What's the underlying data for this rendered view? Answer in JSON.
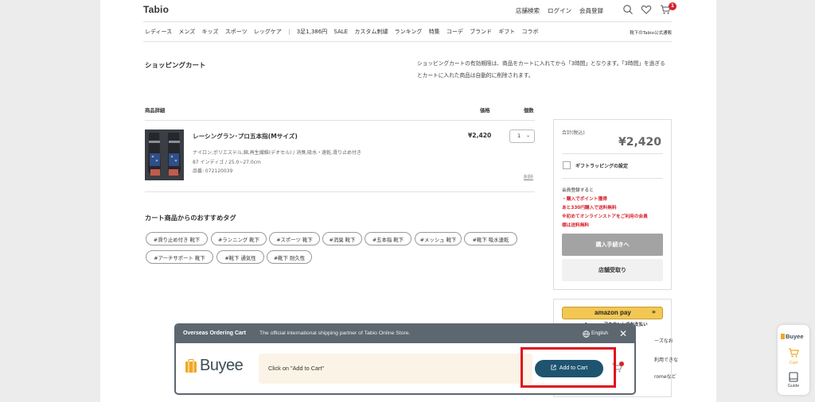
{
  "site": {
    "logo": "Tabio",
    "utility": [
      "店舗検索",
      "ログイン",
      "会員登録"
    ],
    "cart_count": "1",
    "nav": [
      "レディース",
      "メンズ",
      "キッズ",
      "スポーツ",
      "レッグケア",
      "3足1,386円",
      "SALE",
      "カスタム刺繍",
      "ランキング",
      "特集",
      "コーデ",
      "ブランド",
      "ギフト",
      "コラボ"
    ],
    "official_shop": "靴下のTabio公式通販"
  },
  "cart": {
    "title": "ショッピングカート",
    "expiry_note": "ショッピングカートの有効期限は、商品をカートに入れてから「3時間」となります。「3時間」を過ぎるとカートに入れた商品は自動的に削除されます。",
    "headers": {
      "product": "商品詳細",
      "price": "価格",
      "qty": "個数"
    },
    "item": {
      "name": "レーシングラン･プロ五本指(Mサイズ)",
      "material": "ナイロン,ポリエステル,綿,再生繊維(デオセル) / 消臭,吸水・速乾,滑り止め付き",
      "variant": "87 インディゴ / 25.0~27.0cm",
      "sku": "品番: 072120039",
      "price": "¥2,420",
      "qty": "1",
      "delete": "削除"
    },
    "recommend_title": "カート商品からのおすすめタグ",
    "tags": [
      "#滑り止め付き 靴下",
      "#ランニング 靴下",
      "#スポーツ 靴下",
      "#消臭 靴下",
      "#五本指 靴下",
      "#メッシュ 靴下",
      "#靴下 吸水速乾",
      "#アーチサポート 靴下",
      "#靴下 通気性",
      "#靴下 耐久性"
    ]
  },
  "summary": {
    "total_label": "合計(税込)",
    "total": "¥2,420",
    "gift_wrap": "ギフトラッピングの設定",
    "member_lines": [
      "会員登録すると",
      "・購入でポイント獲得",
      "あと330円購入で送料無料",
      "※初めてオンラインストアをご利用の会員",
      "様は送料無料"
    ],
    "checkout": "購入手続きへ",
    "store_pickup": "店舗受取り"
  },
  "amazon": {
    "label": "amazon pay",
    "note": "Amazonアカウントでお支払い",
    "fragments": [
      "ーズなお",
      "利用できな",
      "romeなど"
    ]
  },
  "buyee": {
    "head_title": "Overseas Ordering Cart",
    "head_tagline": "The official international shipping partner of Tabio Online Store.",
    "language": "English",
    "logo": "Buyee",
    "instruction": "Click on \"Add to Cart\"",
    "add_to_cart": "Add to Cart"
  },
  "dock": {
    "logo": "Buyee",
    "cart_label": "Cart",
    "guide_label": "Guide"
  },
  "colors": {
    "buyee_header": "#5c6770",
    "buyee_button": "#1e5470",
    "highlight": "#e0101c",
    "badge": "#d8222f",
    "accent_orange": "#f0a825"
  }
}
